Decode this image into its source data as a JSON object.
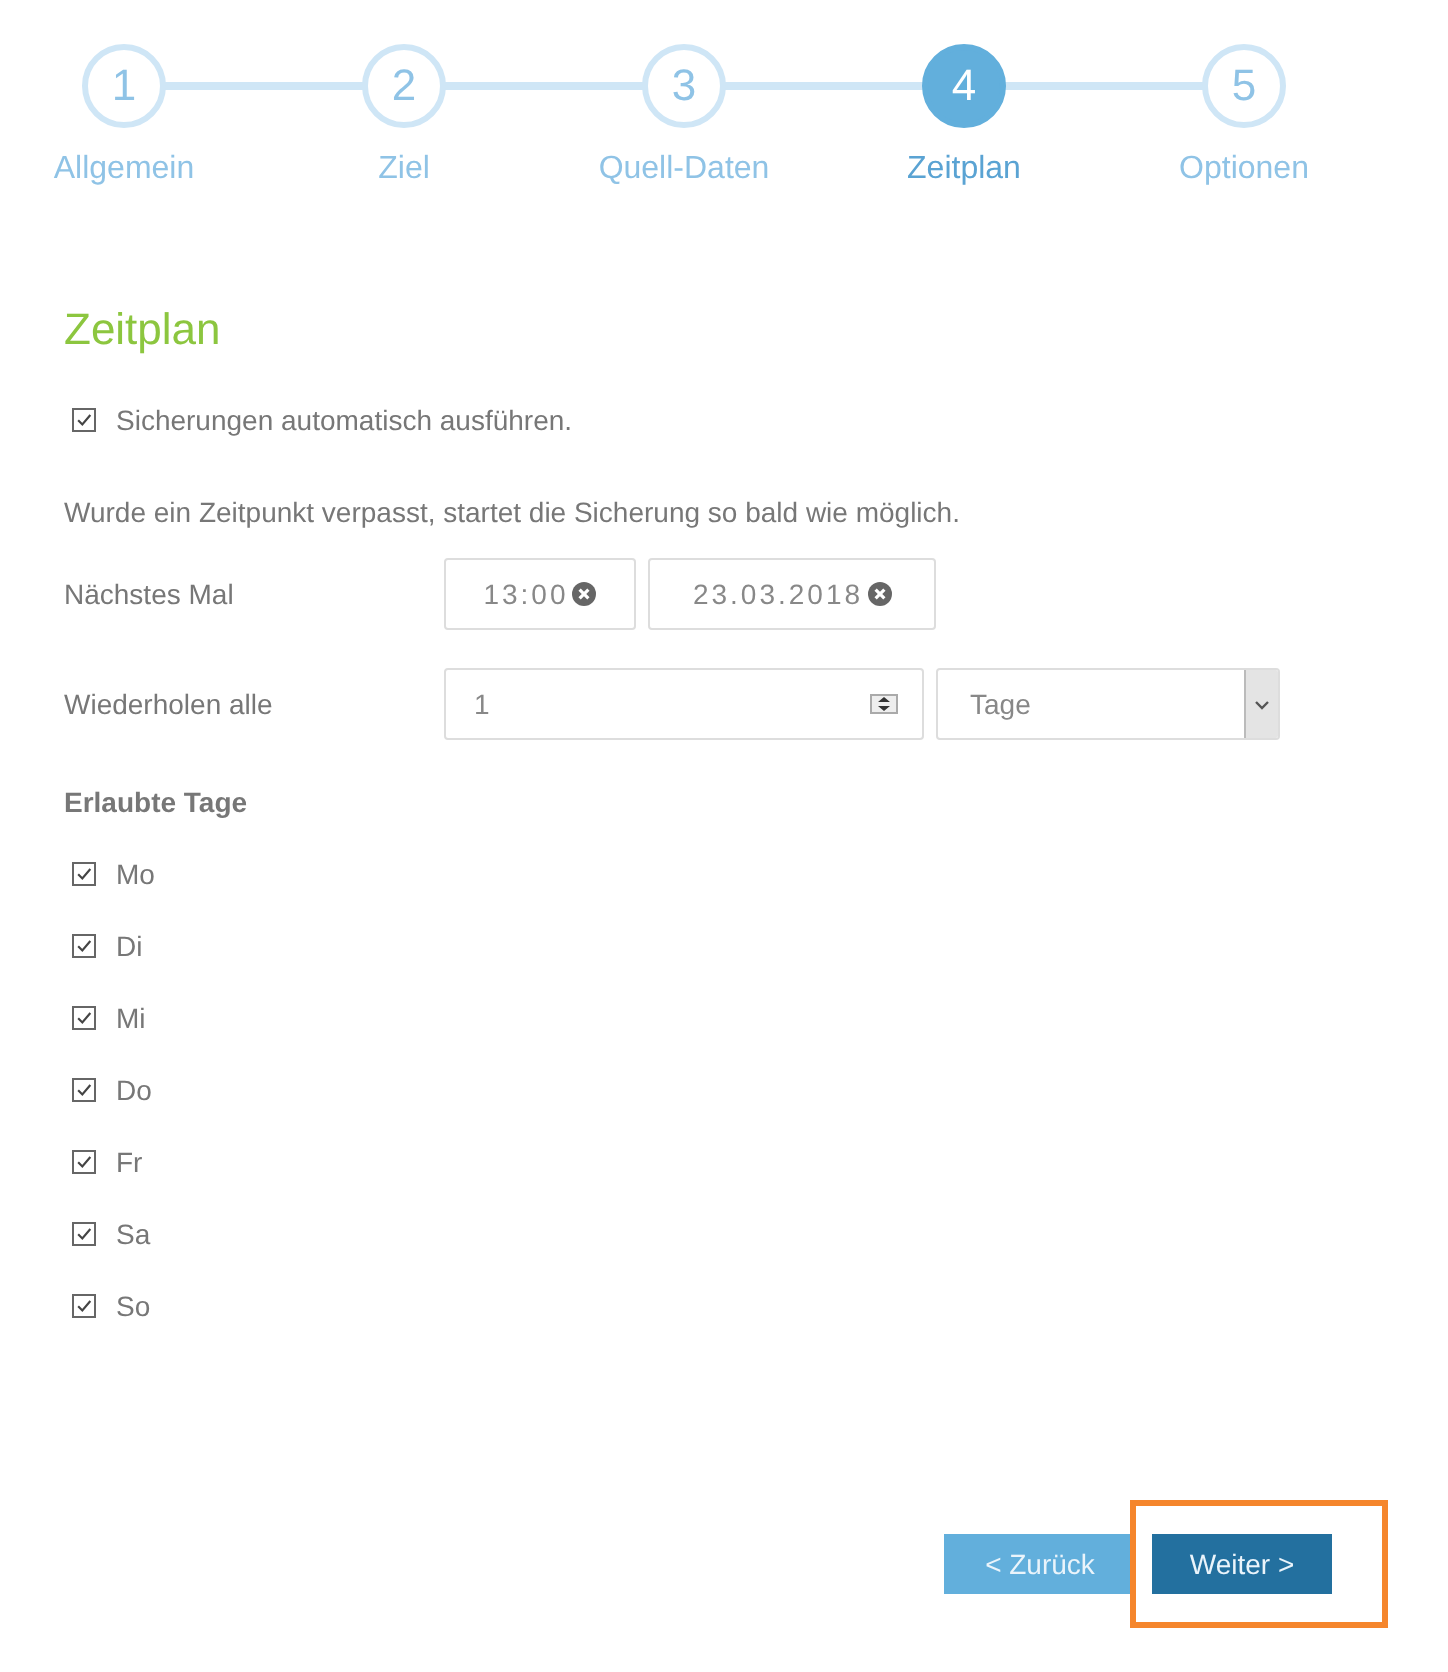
{
  "steps": [
    {
      "number": "1",
      "label": "Allgemein",
      "selected": false
    },
    {
      "number": "2",
      "label": "Ziel",
      "selected": false
    },
    {
      "number": "3",
      "label": "Quell-Daten",
      "selected": false
    },
    {
      "number": "4",
      "label": "Zeitplan",
      "selected": true
    },
    {
      "number": "5",
      "label": "Optionen",
      "selected": false
    }
  ],
  "title": "Zeitplan",
  "auto_run": {
    "label": "Sicherungen automatisch ausführen.",
    "checked": true
  },
  "note": "Wurde ein Zeitpunkt verpasst, startet die Sicherung so bald wie möglich.",
  "next_time": {
    "label": "Nächstes Mal",
    "time": "13:00",
    "date": "23.03.2018"
  },
  "repeat": {
    "label": "Wiederholen alle",
    "value": "1",
    "unit": "Tage"
  },
  "allowed_days": {
    "heading": "Erlaubte Tage",
    "days": [
      {
        "label": "Mo",
        "checked": true
      },
      {
        "label": "Di",
        "checked": true
      },
      {
        "label": "Mi",
        "checked": true
      },
      {
        "label": "Do",
        "checked": true
      },
      {
        "label": "Fr",
        "checked": true
      },
      {
        "label": "Sa",
        "checked": true
      },
      {
        "label": "So",
        "checked": true
      }
    ]
  },
  "buttons": {
    "back": "< Zurück",
    "next": "Weiter >",
    "next_highlighted": true
  }
}
